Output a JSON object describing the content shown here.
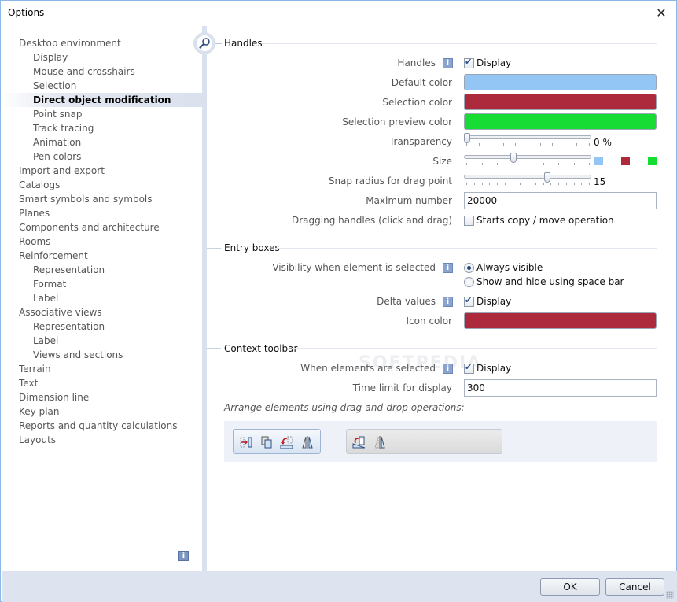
{
  "window": {
    "title": "Options",
    "close_icon": "close-icon"
  },
  "nav": {
    "items": [
      {
        "label": "Desktop environment",
        "level": 0
      },
      {
        "label": "Display",
        "level": 1
      },
      {
        "label": "Mouse and crosshairs",
        "level": 1
      },
      {
        "label": "Selection",
        "level": 1
      },
      {
        "label": "Direct object modification",
        "level": 1,
        "active": true
      },
      {
        "label": "Point snap",
        "level": 1
      },
      {
        "label": "Track tracing",
        "level": 1
      },
      {
        "label": "Animation",
        "level": 1
      },
      {
        "label": "Pen colors",
        "level": 1
      },
      {
        "label": "Import and export",
        "level": 0
      },
      {
        "label": "Catalogs",
        "level": 0
      },
      {
        "label": "Smart symbols and symbols",
        "level": 0
      },
      {
        "label": "Planes",
        "level": 0
      },
      {
        "label": "Components and architecture",
        "level": 0
      },
      {
        "label": "Rooms",
        "level": 0
      },
      {
        "label": "Reinforcement",
        "level": 0
      },
      {
        "label": "Representation",
        "level": 1
      },
      {
        "label": "Format",
        "level": 1
      },
      {
        "label": "Label",
        "level": 1
      },
      {
        "label": "Associative views",
        "level": 0
      },
      {
        "label": "Representation",
        "level": 1
      },
      {
        "label": "Label",
        "level": 1
      },
      {
        "label": "Views and sections",
        "level": 1
      },
      {
        "label": "Terrain",
        "level": 0
      },
      {
        "label": "Text",
        "level": 0
      },
      {
        "label": "Dimension line",
        "level": 0
      },
      {
        "label": "Key plan",
        "level": 0
      },
      {
        "label": "Reports and quantity calculations",
        "level": 0
      },
      {
        "label": "Layouts",
        "level": 0
      }
    ],
    "info_icon": "i"
  },
  "handles": {
    "section_title": "Handles",
    "handles_label": "Handles",
    "handles_display_label": "Display",
    "handles_display_checked": true,
    "default_color_label": "Default color",
    "default_color": "#93c6f4",
    "selection_color_label": "Selection color",
    "selection_color": "#ad2a3c",
    "selection_preview_color_label": "Selection preview color",
    "selection_preview_color": "#16dc33",
    "transparency_label": "Transparency",
    "transparency_value": 0,
    "transparency_text": "0 %",
    "size_label": "Size",
    "size_fraction": 0.38,
    "snap_radius_label": "Snap radius for drag point",
    "snap_radius_value": 15,
    "snap_radius_text": "15",
    "snap_radius_fraction": 0.66,
    "max_number_label": "Maximum number",
    "max_number_value": "20000",
    "dragging_label": "Dragging handles (click and drag)",
    "dragging_option_label": "Starts copy / move operation",
    "dragging_checked": false
  },
  "entry_boxes": {
    "section_title": "Entry boxes",
    "visibility_label": "Visibility when element is selected",
    "visibility_options": [
      "Always visible",
      "Show and hide using space bar"
    ],
    "visibility_selected": 0,
    "delta_label": "Delta values",
    "delta_display_label": "Display",
    "delta_checked": true,
    "icon_color_label": "Icon color",
    "icon_color": "#ad2a3c"
  },
  "context_toolbar": {
    "section_title": "Context toolbar",
    "when_selected_label": "When elements are selected",
    "when_selected_display_label": "Display",
    "when_selected_checked": true,
    "time_limit_label": "Time limit for display",
    "time_limit_value": "300",
    "hint": "Arrange elements using drag-and-drop operations:",
    "active_tools": [
      "move-icon",
      "copy-icon",
      "rotate-copy-icon",
      "mirror-icon"
    ],
    "available_tools": [
      "modify-icon",
      "mirror-copy-icon"
    ]
  },
  "footer": {
    "ok_label": "OK",
    "cancel_label": "Cancel"
  },
  "watermark": "SOFTPEDIA"
}
